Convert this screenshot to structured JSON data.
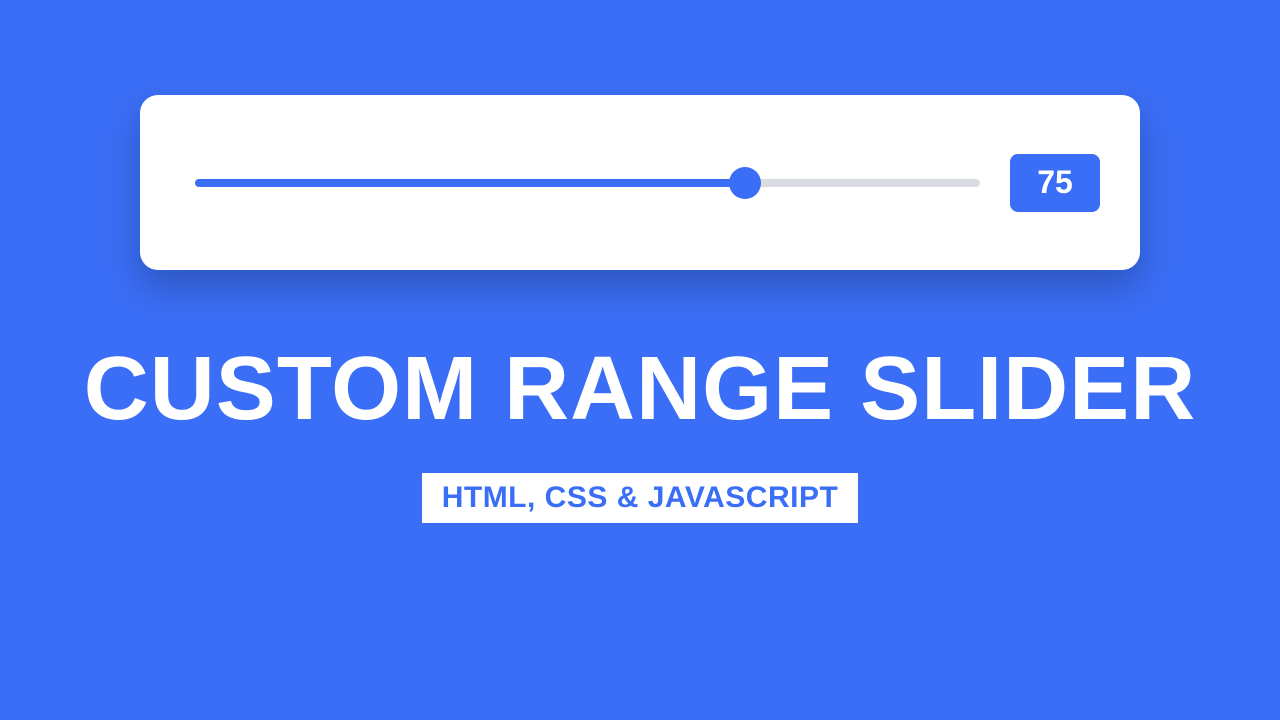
{
  "slider": {
    "value": 75,
    "min": 0,
    "max": 100,
    "value_display": "75",
    "fill_percent": "70%",
    "thumb_percent": "70%"
  },
  "title": "CUSTOM RANGE SLIDER",
  "subtitle": "HTML, CSS & JAVASCRIPT",
  "colors": {
    "primary": "#3b6ef6",
    "track": "#d9dde3",
    "card": "#ffffff"
  }
}
